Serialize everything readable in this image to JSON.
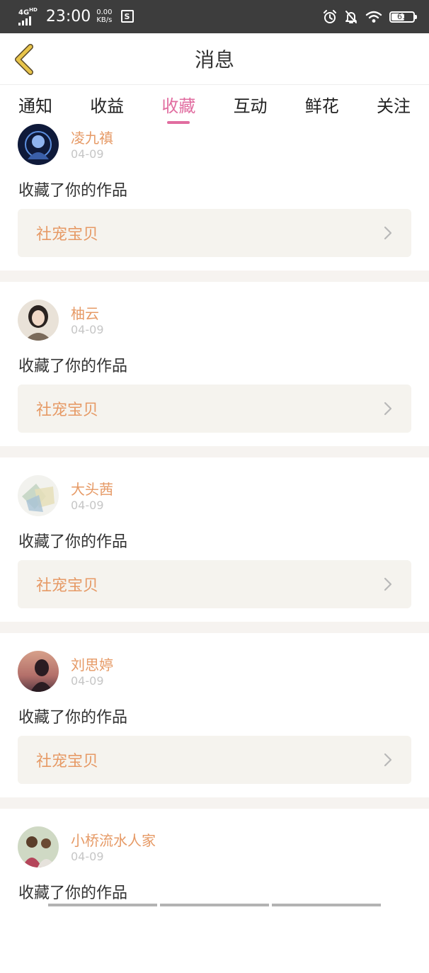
{
  "status_bar": {
    "network_type": "4G",
    "network_sub": "HD",
    "time": "23:00",
    "speed_value": "0.00",
    "speed_unit": "KB/s",
    "s_icon_label": "S",
    "battery": "61",
    "battery_level_percent": 61,
    "icons": [
      "signal-icon",
      "s-app-icon",
      "alarm-icon",
      "bell-off-icon",
      "wifi-icon",
      "battery-icon"
    ]
  },
  "header": {
    "title": "消息",
    "back_icon": "chevron-left-icon"
  },
  "tabs": [
    {
      "label": "通知",
      "active": false
    },
    {
      "label": "收益",
      "active": false
    },
    {
      "label": "收藏",
      "active": true
    },
    {
      "label": "互动",
      "active": false
    },
    {
      "label": "鲜花",
      "active": false
    },
    {
      "label": "关注",
      "active": false
    }
  ],
  "items": [
    {
      "name": "凌九禛",
      "date": "04-09",
      "action": "收藏了你的作品",
      "work": "社宠宝贝"
    },
    {
      "name": "柚云",
      "date": "04-09",
      "action": "收藏了你的作品",
      "work": "社宠宝贝"
    },
    {
      "name": "大头茜",
      "date": "04-09",
      "action": "收藏了你的作品",
      "work": "社宠宝贝"
    },
    {
      "name": "刘思婷",
      "date": "04-09",
      "action": "收藏了你的作品",
      "work": "社宠宝贝"
    },
    {
      "name": "小桥流水人家",
      "date": "04-09",
      "action": "收藏了你的作品",
      "work": ""
    }
  ],
  "colors": {
    "accent": "#e16da0",
    "name": "#e69a66",
    "date": "#c6c6c6",
    "link_bg": "#f5f3ee",
    "separator": "#f6f3f0",
    "back_icon": "#e8c44a",
    "status_bar": "#3d3d3d"
  }
}
